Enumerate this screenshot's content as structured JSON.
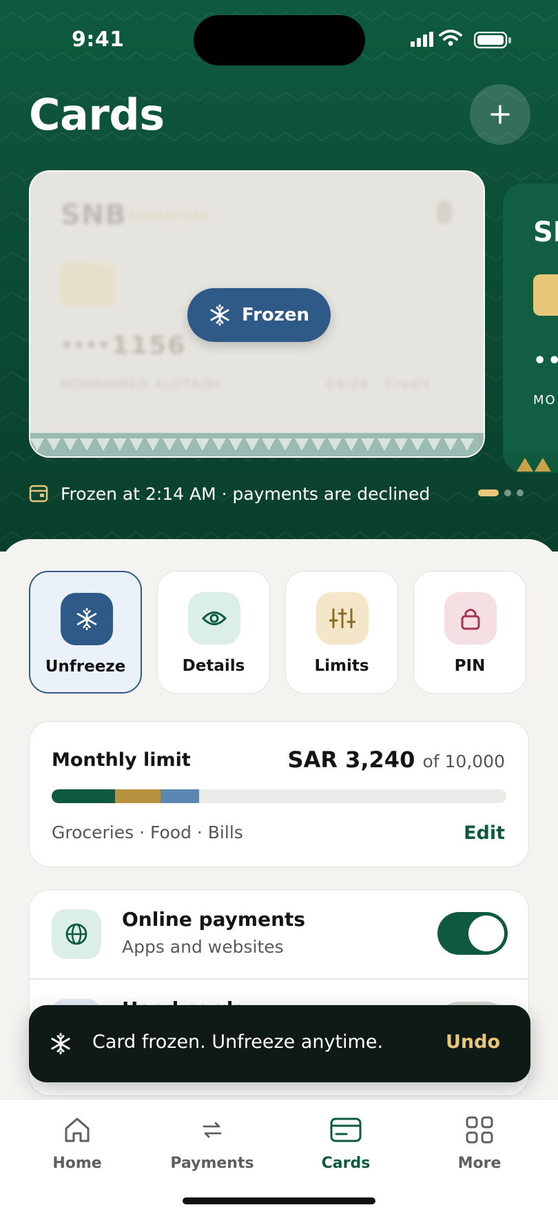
{
  "status_bar": {
    "time": "9:41"
  },
  "header": {
    "title": "Cards",
    "add_icon": "plus-icon"
  },
  "frozen_card": {
    "bank": "SNB",
    "tier": "SIGNATURE",
    "number_mask": "••••",
    "last4": "1156",
    "holder": "MOHAMMED ALOTAIBI",
    "expiry_type": "09/29 · Credit",
    "status_label": "Frozen",
    "status_icon": "snowflake-icon"
  },
  "next_card": {
    "bank": "SNB",
    "number_mask": "•••",
    "holder_prefix": "MO"
  },
  "frozen_note": {
    "icon": "card-icon",
    "text": "Frozen at 2:14 AM · payments are declined"
  },
  "carousel": {
    "pages": 3,
    "active": 0
  },
  "actions": [
    {
      "label": "Unfreeze",
      "icon": "snowflake-icon",
      "selected": true,
      "icon_bg": "#2f5a87"
    },
    {
      "label": "Details",
      "icon": "eye-icon",
      "selected": false,
      "icon_bg": "#dcefe6"
    },
    {
      "label": "Limits",
      "icon": "sliders-icon",
      "selected": false,
      "icon_bg": "#f3e6c9"
    },
    {
      "label": "PIN",
      "icon": "lock-icon",
      "selected": false,
      "icon_bg": "#f6dfe3"
    }
  ],
  "monthly_limit": {
    "title": "Monthly limit",
    "amount": "SAR 3,240",
    "of_text": "of 10,000",
    "spent": 3240,
    "limit": 10000,
    "segments": [
      {
        "category": "Groceries",
        "value": 1400,
        "color": "#0f5a3e"
      },
      {
        "category": "Food",
        "value": 1000,
        "color": "#b8913f"
      },
      {
        "category": "Bills",
        "value": 840,
        "color": "#5b86b1"
      }
    ],
    "categories_text": "Groceries · Food · Bills",
    "edit_label": "Edit"
  },
  "settings": [
    {
      "title": "Online payments",
      "subtitle": "Apps and websites",
      "icon": "globe-icon",
      "enabled": true
    },
    {
      "title": "Hand cards",
      "subtitle": "",
      "icon": "hand-icon",
      "enabled": false
    }
  ],
  "toast": {
    "icon": "snowflake-icon",
    "message": "Card frozen. Unfreeze anytime.",
    "action": "Undo"
  },
  "tabs": [
    {
      "label": "Home",
      "icon": "home-icon",
      "active": false
    },
    {
      "label": "Payments",
      "icon": "transfer-icon",
      "active": false
    },
    {
      "label": "Cards",
      "icon": "card-icon",
      "active": true
    },
    {
      "label": "More",
      "icon": "grid-icon",
      "active": false
    }
  ],
  "colors": {
    "brand_green": "#0f5a3e",
    "frozen_blue": "#2f5a87",
    "accent_gold": "#e8c77a"
  }
}
